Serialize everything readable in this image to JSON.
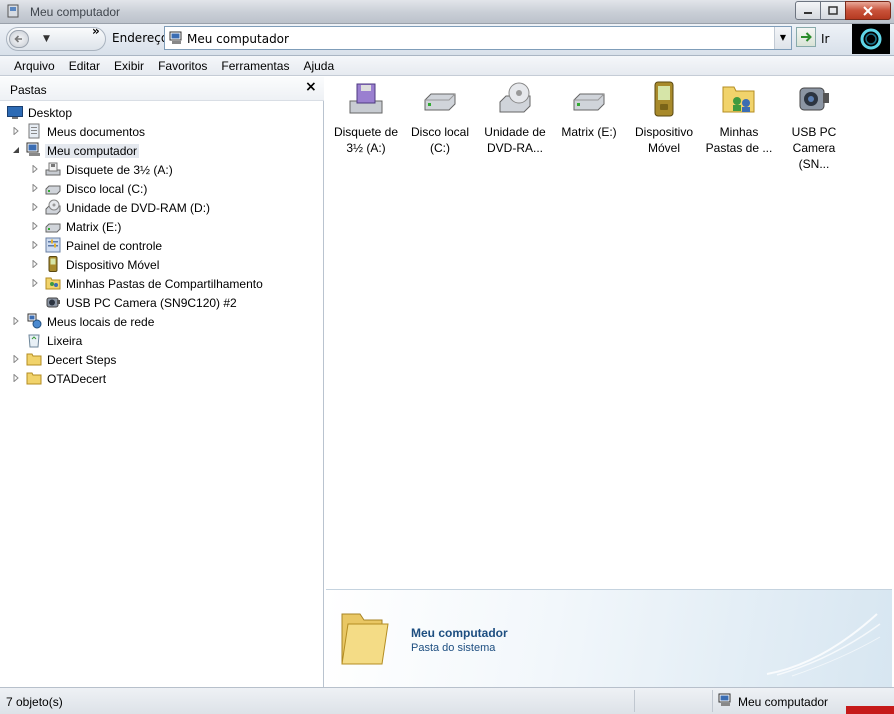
{
  "window": {
    "title": "Meu computador"
  },
  "navbar": {
    "address_label": "Endereço",
    "address_value": "Meu computador",
    "go_label": "Ir",
    "chevron": "»"
  },
  "menu": [
    {
      "label": "Arquivo"
    },
    {
      "label": "Editar"
    },
    {
      "label": "Exibir"
    },
    {
      "label": "Favoritos"
    },
    {
      "label": "Ferramentas"
    },
    {
      "label": "Ajuda"
    }
  ],
  "folder_pane": {
    "header": "Pastas",
    "close": "×",
    "tree": [
      {
        "label": "Desktop",
        "icon": "desktop-icon"
      },
      {
        "label": "Meus documentos",
        "icon": "documents-icon"
      },
      {
        "label": "Meu computador",
        "icon": "computer-icon"
      },
      {
        "label": "Disquete de 3½ (A:)",
        "icon": "floppy-icon"
      },
      {
        "label": "Disco local (C:)",
        "icon": "hard-drive-icon"
      },
      {
        "label": "Unidade de DVD-RAM (D:)",
        "icon": "dvd-drive-icon"
      },
      {
        "label": "Matrix (E:)",
        "icon": "hard-drive-icon"
      },
      {
        "label": "Painel de controle",
        "icon": "control-panel-icon"
      },
      {
        "label": "Dispositivo Móvel",
        "icon": "mobile-device-icon"
      },
      {
        "label": "Minhas Pastas de Compartilhamento",
        "icon": "shared-folders-icon"
      },
      {
        "label": "USB PC Camera (SN9C120) #2",
        "icon": "camera-icon"
      },
      {
        "label": "Meus locais de rede",
        "icon": "network-icon"
      },
      {
        "label": "Lixeira",
        "icon": "recycle-bin-icon"
      },
      {
        "label": "Decert Steps",
        "icon": "folder-icon"
      },
      {
        "label": "OTADecert",
        "icon": "folder-icon"
      }
    ]
  },
  "content": {
    "items": [
      {
        "label": "Disquete de 3½ (A:)",
        "icon": "floppy-icon"
      },
      {
        "label": "Disco local (C:)",
        "icon": "hard-drive-icon"
      },
      {
        "label": "Unidade de DVD-RA...",
        "icon": "dvd-drive-icon"
      },
      {
        "label": "Matrix (E:)",
        "icon": "hard-drive-icon"
      },
      {
        "label": "Dispositivo Móvel",
        "icon": "mobile-device-icon"
      },
      {
        "label": "Minhas Pastas de ...",
        "icon": "shared-folders-icon"
      },
      {
        "label": "USB PC Camera (SN...",
        "icon": "camera-icon"
      }
    ]
  },
  "details": {
    "title": "Meu computador",
    "subtitle": "Pasta do sistema"
  },
  "status": {
    "count": "7 objeto(s)",
    "location": "Meu computador"
  },
  "colors": {
    "details_text": "#1d4e80",
    "close_button": "#c8523a",
    "status_red": "#c61a1a"
  }
}
